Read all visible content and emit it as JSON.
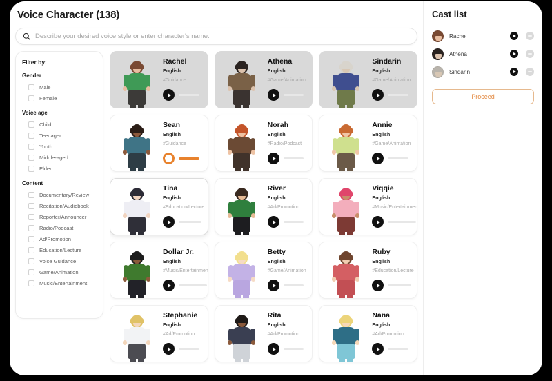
{
  "header": {
    "title": "Voice Character (138)"
  },
  "search": {
    "icon": "search-icon",
    "value": "",
    "placeholder": "Describe your desired voice style or enter character's name."
  },
  "filters": {
    "title": "Filter by:",
    "groups": [
      {
        "label": "Gender",
        "options": [
          "Male",
          "Female"
        ]
      },
      {
        "label": "Voice age",
        "options": [
          "Child",
          "Teenager",
          "Youth",
          "Middle-aged",
          "Elder"
        ]
      },
      {
        "label": "Content",
        "options": [
          "Documentary/Review",
          "Recitation/Audiobook",
          "Reporter/Announcer",
          "Radio/Podcast",
          "Ad/Promotion",
          "Education/Lecture",
          "Voice Guidance",
          "Game/Animation",
          "Music/Entertainment"
        ]
      }
    ]
  },
  "characters": [
    {
      "name": "Rachel",
      "language": "English",
      "tag": "#Guidance",
      "state": "selected",
      "skin": "#e8bda0",
      "hair": "#7a4a33",
      "outfit": "#3f9a56",
      "lower": "#3c3a38"
    },
    {
      "name": "Athena",
      "language": "English",
      "tag": "#Game/Animation",
      "state": "selected",
      "skin": "#ddc3ae",
      "hair": "#2a2320",
      "outfit": "#7a6147",
      "lower": "#3a3330"
    },
    {
      "name": "Sindarin",
      "language": "English",
      "tag": "#Game/Animation",
      "state": "selected",
      "skin": "#d8c7b4",
      "hair": "#d8d4cc",
      "outfit": "#3f4e8f",
      "lower": "#6f7a4a"
    },
    {
      "name": "Sean",
      "language": "English",
      "tag": "#Guidance",
      "state": "playing",
      "skin": "#8d5a3c",
      "hair": "#2b1d16",
      "outfit": "#3f7486",
      "lower": "#2e3d45"
    },
    {
      "name": "Norah",
      "language": "English",
      "tag": "#Radio/Podcast",
      "state": "normal",
      "skin": "#eec3a4",
      "hair": "#c4552a",
      "outfit": "#6b4a34",
      "lower": "#40322a"
    },
    {
      "name": "Annie",
      "language": "English",
      "tag": "#Game/Animation",
      "state": "normal",
      "skin": "#f0c7a8",
      "hair": "#c96a32",
      "outfit": "#cfe08e",
      "lower": "#6b5a48"
    },
    {
      "name": "Tina",
      "language": "English",
      "tag": "#Education/Lecture",
      "state": "hovered",
      "skin": "#f1d4c0",
      "hair": "#2c2b36",
      "outfit": "#eeeef4",
      "lower": "#2f2f38"
    },
    {
      "name": "River",
      "language": "English",
      "tag": "#Ad/Promotion",
      "state": "normal",
      "skin": "#e7bb96",
      "hair": "#3a2a20",
      "outfit": "#2f7f3d",
      "lower": "#1d1d20"
    },
    {
      "name": "Viqqie",
      "language": "English",
      "tag": "#Music/Entertainment",
      "state": "normal",
      "skin": "#c98e6a",
      "hair": "#e0466b",
      "outfit": "#f3aebc",
      "lower": "#7d3a34"
    },
    {
      "name": "Dollar Jr.",
      "language": "English",
      "tag": "#Music/Entertainment",
      "state": "normal",
      "skin": "#8c5b3b",
      "hair": "#1c1c1c",
      "outfit": "#3f7a2e",
      "lower": "#222228"
    },
    {
      "name": "Betty",
      "language": "English",
      "tag": "#Game/Animation",
      "state": "normal",
      "skin": "#f6dbc4",
      "hair": "#f2df8e",
      "outfit": "#c3b2e6",
      "lower": "#b9a6e0"
    },
    {
      "name": "Ruby",
      "language": "English",
      "tag": "#Education/Lecture",
      "state": "normal",
      "skin": "#f1cdb1",
      "hair": "#6f452e",
      "outfit": "#d45f63",
      "lower": "#c24f54"
    },
    {
      "name": "Stephanie",
      "language": "English",
      "tag": "#Ad/Promotion",
      "state": "normal",
      "skin": "#f3d6bb",
      "hair": "#e0c267",
      "outfit": "#f2f3f5",
      "lower": "#4c4c52"
    },
    {
      "name": "Rita",
      "language": "English",
      "tag": "#Ad/Promotion",
      "state": "normal",
      "skin": "#8b5a3c",
      "hair": "#1f1a18",
      "outfit": "#3a3f52",
      "lower": "#cfd3d8"
    },
    {
      "name": "Nana",
      "language": "English",
      "tag": "#Ad/Promotion",
      "state": "normal",
      "skin": "#f6d8b8",
      "hair": "#ecd47a",
      "outfit": "#2e6e86",
      "lower": "#7fc6d6"
    }
  ],
  "cast_list": {
    "title": "Cast list",
    "members": [
      {
        "name": "Rachel",
        "skin": "#e8bda0",
        "hair": "#7a4a33"
      },
      {
        "name": "Athena",
        "skin": "#ddc3ae",
        "hair": "#2a2320"
      },
      {
        "name": "Sindarin",
        "skin": "#d8c7b4",
        "hair": "#b9b4ac"
      }
    ],
    "play_icon": "play-icon",
    "remove_icon": "minus-icon",
    "proceed_label": "Proceed"
  },
  "colors": {
    "accent_orange": "#e8822d",
    "proceed_text": "#e38a43",
    "selected_card_bg": "#d9d9d9",
    "panel_bg": "#ffffff"
  }
}
